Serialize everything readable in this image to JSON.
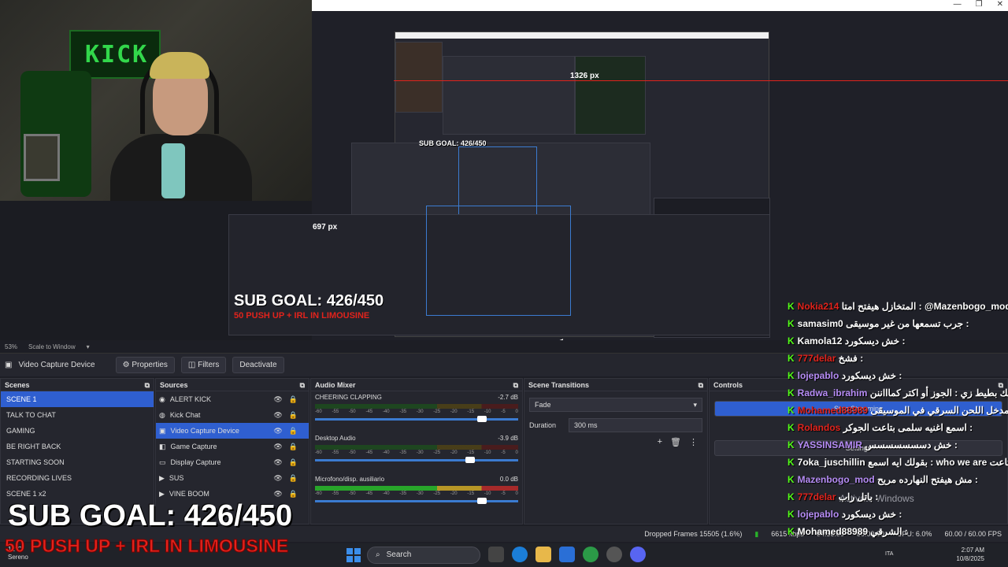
{
  "window": {
    "min": "—",
    "max": "❐",
    "close": "✕"
  },
  "webcam": {
    "banner_text": "KICK"
  },
  "nested": {
    "px_label_1": "1326 px",
    "px_label_2": "697 px",
    "sub_goal_small": "SUB GOAL: 426/450",
    "sub_goal_mid": "SUB GOAL: 426/450",
    "push_mid": "50 PUSH UP + IRL IN LIMOUSINE"
  },
  "zoom": {
    "value": "53%",
    "scale": "Scale to Window"
  },
  "source_toolbar": {
    "source_name": "Video Capture Device",
    "properties": "Properties",
    "filters": "Filters",
    "deactivate": "Deactivate"
  },
  "scenes": {
    "title": "Scenes",
    "items": [
      "SCENE 1",
      "TALK TO CHAT",
      "GAMING",
      "BE RIGHT BACK",
      "STARTING SOON",
      "RECORDING LIVES",
      "SCENE 1 x2"
    ]
  },
  "sources": {
    "title": "Sources",
    "items": [
      "ALERT KICK",
      "Kick Chat",
      "Video Capture Device",
      "Game Capture",
      "Display Capture",
      "SUS",
      "VINE BOOM"
    ]
  },
  "mixer": {
    "title": "Audio Mixer",
    "channels": [
      {
        "name": "CHEERING CLAPPING",
        "db": "-2.7 dB"
      },
      {
        "name": "Desktop Audio",
        "db": "-3.9 dB"
      },
      {
        "name": "Microfono/disp. ausiliario",
        "db": "0.0 dB"
      }
    ],
    "scale": [
      "-60",
      "-55",
      "-50",
      "-45",
      "-40",
      "-35",
      "-30",
      "-25",
      "-20",
      "-15",
      "-10",
      "-5",
      "0"
    ]
  },
  "transitions": {
    "title": "Scene Transitions",
    "type": "Fade",
    "duration_label": "Duration",
    "duration_value": "300 ms"
  },
  "controls": {
    "title": "Controls",
    "stop_streaming": "Stop Streaming",
    "settings": "Settings"
  },
  "chat": [
    {
      "user": "Nokia214",
      "color": "#e2231c",
      "msg": "المتخازل هيفتح امتا : @Mazenbogo_mod"
    },
    {
      "user": "samasim0",
      "color": "#ffffff",
      "msg": "جرب تسمعها من غير موسيقى :"
    },
    {
      "user": "Kamola12",
      "color": "#ffffff",
      "msg": "خش ديسكورد :"
    },
    {
      "user": "777delar",
      "color": "#e2231c",
      "msg": "فشخ :"
    },
    {
      "user": "lojepablo",
      "color": "#b68cf5",
      "msg": "خش ديسكورد :"
    },
    {
      "user": "Radwa_ibrahim",
      "color": "#b68cf5",
      "msg": "يا سيف يا حجازي أنا بحبك بطيط زي : الجوز أو اكتر كماااننن"
    },
    {
      "user": "Mohamed88989",
      "color": "#e2231c",
      "msg": "مدخل اللحن السرقي في الموسيقى :"
    },
    {
      "user": "Rolandos",
      "color": "#e2231c",
      "msg": "اسمع اغنيه سلمى بتاعت الجوكر :"
    },
    {
      "user": "YASSINSAMIR",
      "color": "#b68cf5",
      "msg": "خش دسسسسسسس :"
    },
    {
      "user": "7oka_juschillin",
      "color": "#ffffff",
      "msg": "بقولك ايه اسمع : who we are بتاعت narr"
    },
    {
      "user": "Mazenbogo_mod",
      "color": "#b68cf5",
      "msg": "مش هيفتح النهارده مريح :"
    },
    {
      "user": "777delar",
      "color": "#e2231c",
      "msg": "باتل راب :"
    },
    {
      "user": "lojepablo",
      "color": "#b68cf5",
      "msg": "خش ديسكورد :"
    },
    {
      "user": "Mohamed88989",
      "color": "#ffffff",
      "msg": "الشرقي :"
    }
  ],
  "activate_windows": "Activate Windows",
  "overlay": {
    "sub_goal": "SUB GOAL: 426/450",
    "push": "50 PUSH UP + IRL IN LIMOUSINE"
  },
  "status": {
    "dropped": "Dropped Frames 15505 (1.6%)",
    "kbps": "6615 kbps",
    "stream_time": "04:36:09",
    "rec_time": "00:00:00",
    "cpu": "CPU: 6.0%",
    "fps": "60.00 / 60.00 FPS"
  },
  "taskbar": {
    "weather_temp": "12°C",
    "weather_desc": "Sereno",
    "search": "Search",
    "lang": "ITA",
    "time": "2:07 AM",
    "date": "10/8/2025"
  }
}
